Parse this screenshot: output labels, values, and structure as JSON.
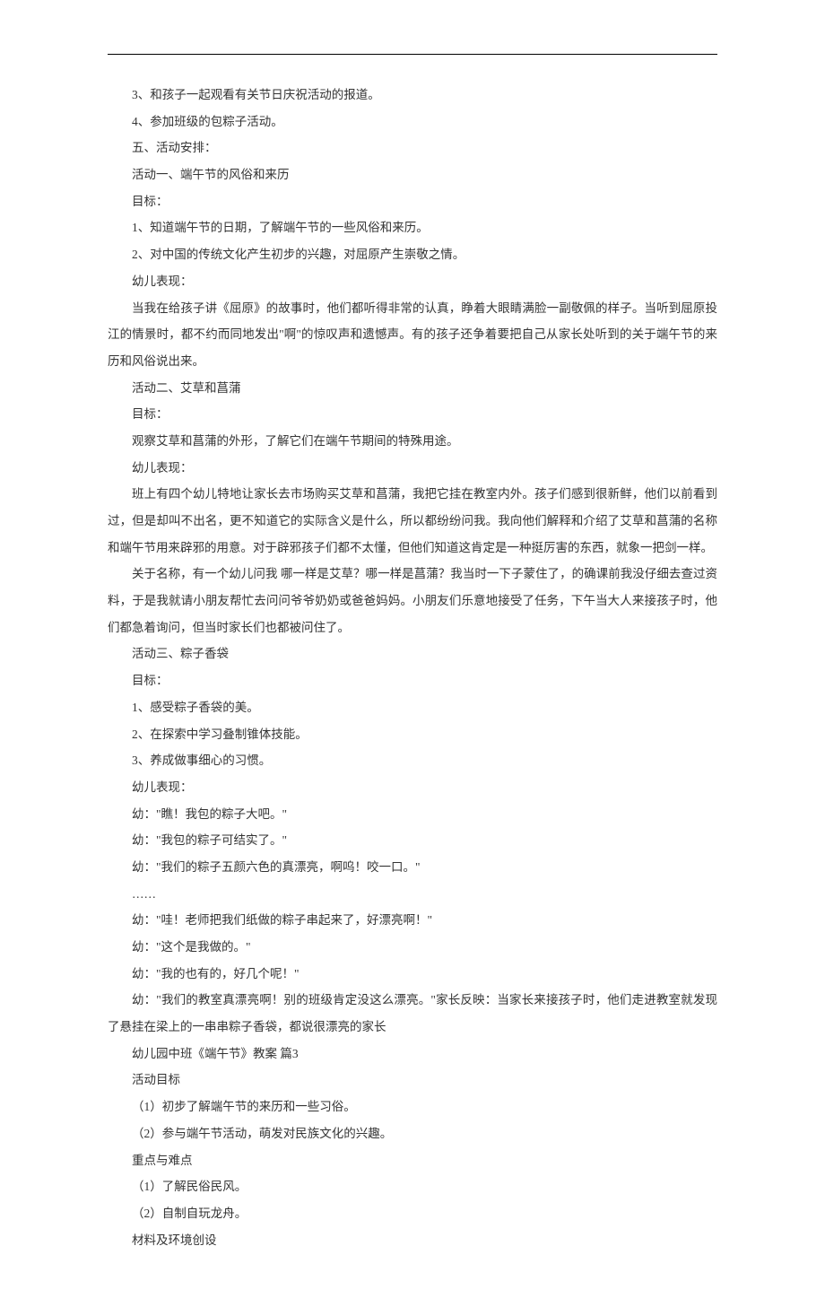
{
  "lines": [
    "3、和孩子一起观看有关节日庆祝活动的报道。",
    "4、参加班级的包粽子活动。",
    "五、活动安排：",
    "活动一、端午节的风俗和来历",
    "目标：",
    "1、知道端午节的日期，了解端午节的一些风俗和来历。",
    "2、对中国的传统文化产生初步的兴趣，对屈原产生崇敬之情。",
    "幼儿表现：",
    "当我在给孩子讲《屈原》的故事时，他们都听得非常的认真，睁着大眼睛满脸一副敬佩的样子。当听到屈原投江的情景时，都不约而同地发出\"啊\"的惊叹声和遗憾声。有的孩子还争着要把自己从家长处听到的关于端午节的来历和风俗说出来。",
    "活动二、艾草和菖蒲",
    "目标：",
    "观察艾草和菖蒲的外形，了解它们在端午节期间的特殊用途。",
    "幼儿表现：",
    "班上有四个幼儿特地让家长去市场购买艾草和菖蒲，我把它挂在教室内外。孩子们感到很新鲜，他们以前看到过，但是却叫不出名，更不知道它的实际含义是什么，所以都纷纷问我。我向他们解释和介绍了艾草和菖蒲的名称和端午节用来辟邪的用意。对于辟邪孩子们都不太懂，但他们知道这肯定是一种挺厉害的东西，就象一把剑一样。",
    "关于名称，有一个幼儿问我 哪一样是艾草？哪一样是菖蒲？我当时一下子蒙住了，的确课前我没仔细去查过资料，于是我就请小朋友帮忙去问问爷爷奶奶或爸爸妈妈。小朋友们乐意地接受了任务，下午当大人来接孩子时，他们都急着询问，但当时家长们也都被问住了。",
    "活动三、粽子香袋",
    "目标：",
    "1、感受粽子香袋的美。",
    "2、在探索中学习叠制锥体技能。",
    "3、养成做事细心的习惯。",
    "幼儿表现：",
    "幼：\"瞧！我包的粽子大吧。\"",
    "幼：\"我包的粽子可结实了。\"",
    "幼：\"我们的粽子五颜六色的真漂亮，啊呜！咬一口。\"",
    "……",
    "幼：\"哇！老师把我们纸做的粽子串起来了，好漂亮啊！\"",
    "幼：\"这个是我做的。\"",
    "幼：\"我的也有的，好几个呢！\"",
    "幼：\"我们的教室真漂亮啊！别的班级肯定没这么漂亮。\"家长反映：当家长来接孩子时，他们走进教室就发现了悬挂在梁上的一串串粽子香袋，都说很漂亮的家长",
    "幼儿园中班《端午节》教案 篇3",
    "活动目标",
    "（1）初步了解端午节的来历和一些习俗。",
    "（2）参与端午节活动，萌发对民族文化的兴趣。",
    "重点与难点",
    "（1）了解民俗民风。",
    "（2）自制自玩龙舟。",
    "材料及环境创设"
  ]
}
